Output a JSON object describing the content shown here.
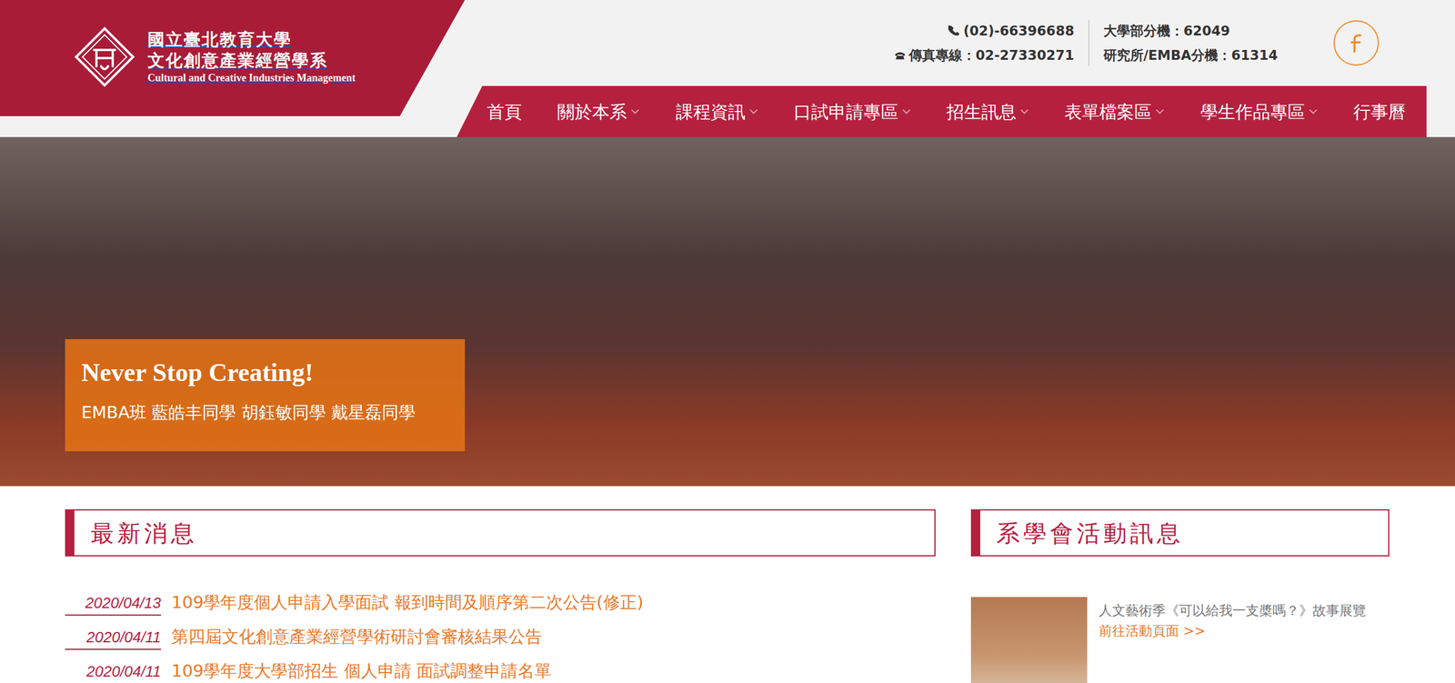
{
  "header": {
    "logo": {
      "lines": [
        "國立臺北教育大學",
        "文化創意產業經營學系",
        "Cultural and Creative Industries Management"
      ]
    },
    "contact": {
      "phone": "(02)-66396688",
      "fax": "傳真專線：02-27330271",
      "undergrad_ext": "大學部分機：62049",
      "grad_ext": "研究所/EMBA分機：61314"
    }
  },
  "nav": {
    "items": [
      {
        "label": "首頁",
        "has_submenu": false,
        "selected": false
      },
      {
        "label": "關於本系",
        "has_submenu": true,
        "selected": false
      },
      {
        "label": "課程資訊",
        "has_submenu": true,
        "selected": false
      },
      {
        "label": "口試申請專區",
        "has_submenu": true,
        "selected": false
      },
      {
        "label": "招生訊息",
        "has_submenu": true,
        "selected": false
      },
      {
        "label": "表單檔案區",
        "has_submenu": true,
        "selected": false
      },
      {
        "label": "學生作品專區",
        "has_submenu": true,
        "selected": false
      },
      {
        "label": "行事曆",
        "has_submenu": false,
        "selected": false
      }
    ]
  },
  "hero": {
    "title": "Never Stop Creating!",
    "caption": "EMBA班 藍皓丰同學 胡鈺敏同學 戴星磊同學"
  },
  "news": {
    "title": "最新消息",
    "items": [
      {
        "date": "2020/04/13",
        "title": "109學年度個人申請入學面試 報到時間及順序第二次公告(修正)"
      },
      {
        "date": "2020/04/11",
        "title": "第四屆文化創意產業經營學術研討會審核結果公告"
      },
      {
        "date": "2020/04/11",
        "title": "109學年度大學部招生 個人申請 面試調整申請名單"
      }
    ]
  },
  "activities": {
    "title": "系學會活動訊息",
    "items": [
      {
        "title": "人文藝術季《可以給我一支槳嗎？》故事展覽",
        "link": "前往活動頁面 >>"
      }
    ]
  }
}
